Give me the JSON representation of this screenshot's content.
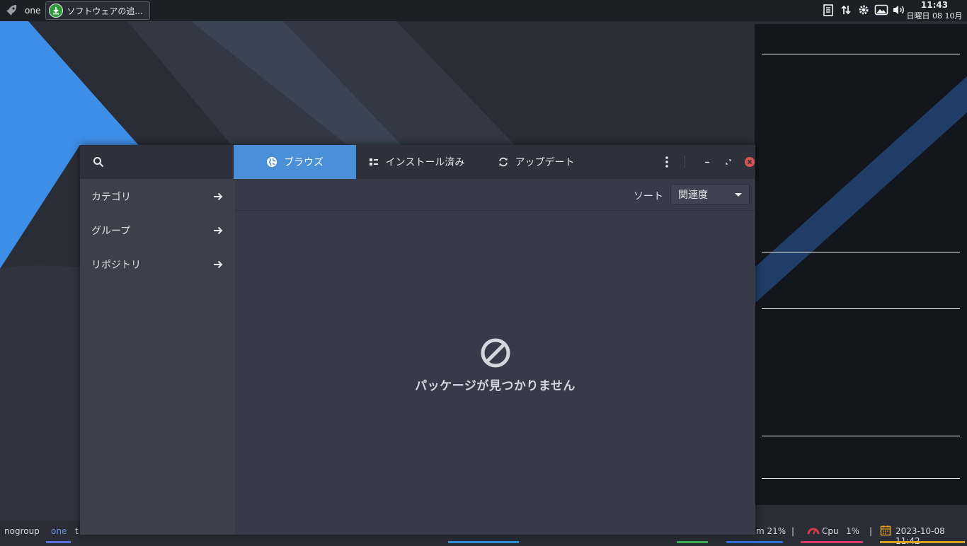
{
  "top_panel": {
    "workspace": "one",
    "task_title": "ソフトウェアの追...",
    "clock_time": "11:43",
    "clock_date": "日曜日 08 10月"
  },
  "window": {
    "sidebar": {
      "items": [
        {
          "label": "カテゴリ"
        },
        {
          "label": "グループ"
        },
        {
          "label": "リポジトリ"
        }
      ]
    },
    "tabs": [
      {
        "label": "ブラウズ",
        "icon": "globe-icon",
        "active": true
      },
      {
        "label": "インストール済み",
        "icon": "list-icon",
        "active": false
      },
      {
        "label": "アップデート",
        "icon": "refresh-icon",
        "active": false
      }
    ],
    "sort_label": "ソート",
    "sort_value": "関連度",
    "empty_message": "パッケージが見つかりません"
  },
  "bottom_bar": {
    "group": "nogroup",
    "workspace_one": "one",
    "workspace_two_partial": "t",
    "mem_partial": "m 21%",
    "cpu_label": "Cpu",
    "cpu_value": "1%",
    "datetime": "2023-10-08 11:42",
    "separator": "|"
  },
  "colors": {
    "accent": "#4a90d9",
    "close_button": "#d9534f",
    "window_bg": "#373a49",
    "sidebar_bg": "#3c404b",
    "headerbar_bg": "#2e313c"
  }
}
